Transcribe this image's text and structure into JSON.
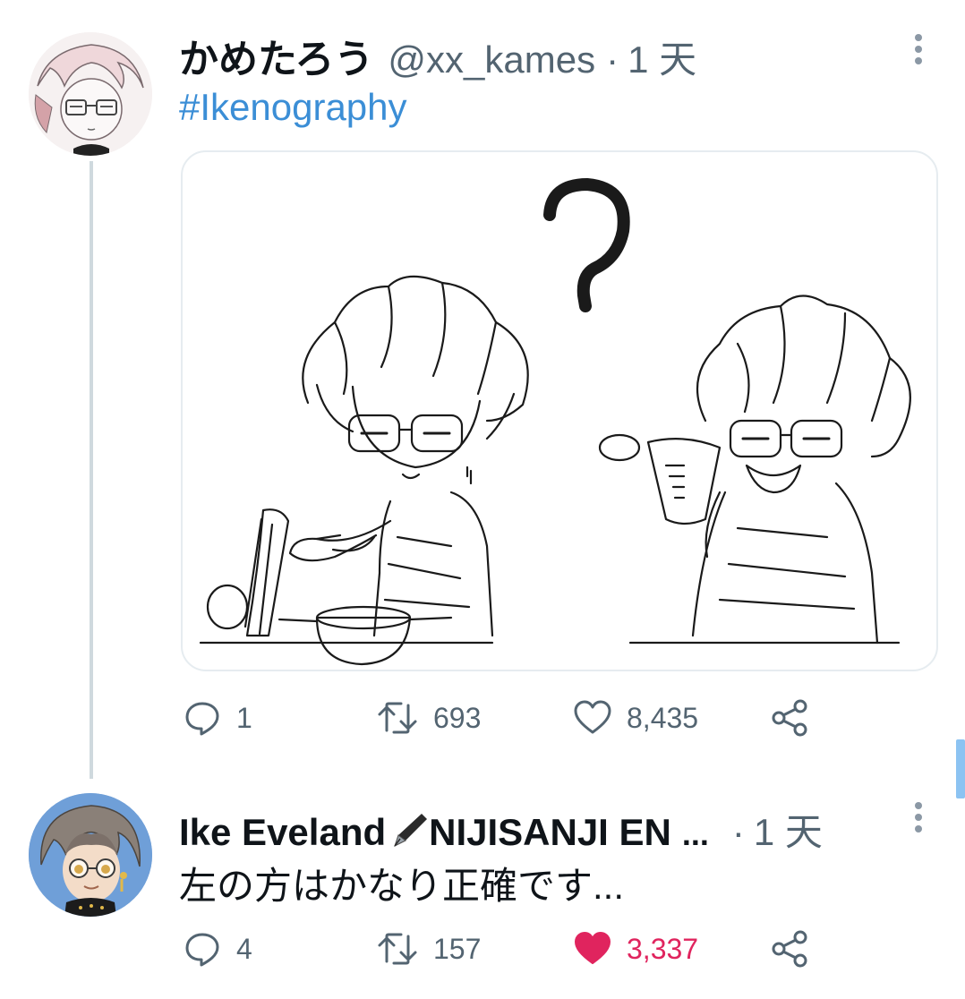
{
  "tweets": [
    {
      "display_name": "かめたろう",
      "handle": "@xx_kames",
      "dot": "·",
      "time": "1 天",
      "text": "#Ikenography",
      "media": {
        "question_mark": "?"
      },
      "actions": {
        "reply_count": "1",
        "retweet_count": "693",
        "like_count": "8,435",
        "liked": false
      }
    },
    {
      "display_name": "Ike Eveland",
      "name_suffix": "NIJISANJI EN",
      "name_ellipsis": "...",
      "dot": "·",
      "time": "1 天",
      "text": "左の方はかなり正確です...",
      "actions": {
        "reply_count": "4",
        "retweet_count": "157",
        "like_count": "3,337",
        "liked": true
      }
    }
  ],
  "icons": {
    "reply": "reply-icon",
    "retweet": "retweet-icon",
    "like": "heart-icon",
    "share": "share-icon",
    "more": "more-vertical-icon",
    "pen": "fountain-pen-icon"
  },
  "colors": {
    "link": "#3b8ed6",
    "like_active": "#e0245e",
    "secondary_text": "#536471",
    "thread_line": "#cfd9de"
  }
}
